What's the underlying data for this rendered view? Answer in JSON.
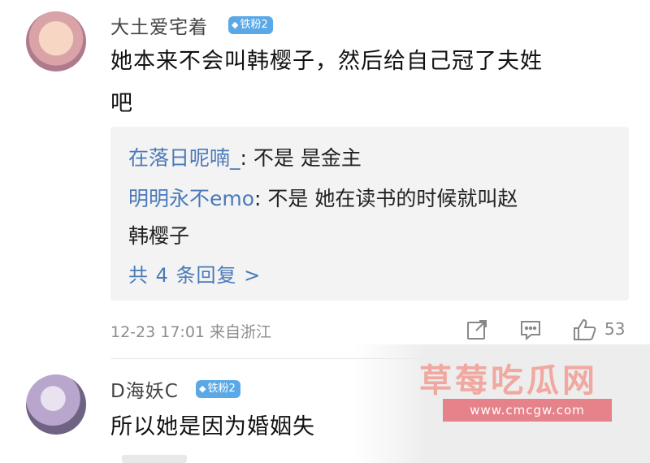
{
  "comment1": {
    "username": "大土爱宅着",
    "badge": "铁粉2",
    "badge_icon": "diamond-icon",
    "content_line1": "她本来不会叫韩樱子，然后给自己冠了夫姓",
    "content_line2": "吧",
    "replies": [
      {
        "name": "在落日呢喃_",
        "text": ": 不是 是金主"
      },
      {
        "name": "明明永不emo",
        "text": ": 不是 她在读书的时候就叫赵",
        "text2": "韩樱子"
      }
    ],
    "more_replies": "共 4 条回复 >",
    "timestamp": "12-23 17:01 来自浙江",
    "like_count": "53",
    "icons": [
      "share-icon",
      "comment-icon",
      "like-icon"
    ]
  },
  "comment2": {
    "username": "D海妖C",
    "badge": "铁粉2",
    "content": "所以她是因为婚姻失"
  },
  "watermark": {
    "title": "草莓吃瓜网",
    "url": "www.cmcgw.com"
  },
  "colors": {
    "badge": "#5aa9e6",
    "reply_name": "#4a7ab8",
    "watermark_pink": "#e5828a"
  }
}
